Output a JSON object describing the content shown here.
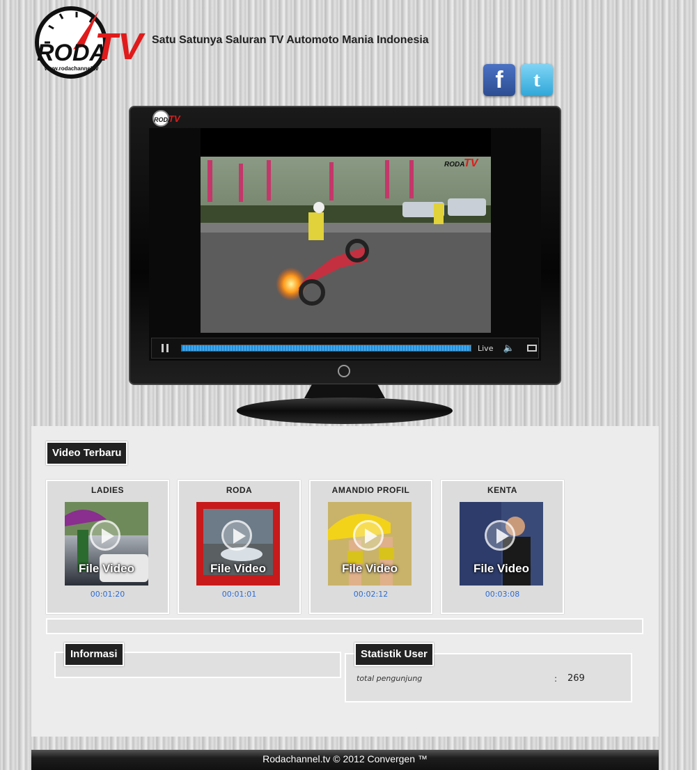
{
  "header": {
    "logo_text": "RODA",
    "logo_tv": "TV",
    "logo_url": "www.rodachannel.tv",
    "tagline": "Satu Satunya Saluran TV Automoto Mania Indonesia"
  },
  "social": {
    "facebook_glyph": "f",
    "twitter_glyph": "t"
  },
  "player": {
    "live_label": "Live",
    "progress": 1.0
  },
  "video_section": {
    "title": "Video Terbaru",
    "items": [
      {
        "title": "LADIES",
        "overlay": "File Video",
        "duration": "00:01:20"
      },
      {
        "title": "RODA",
        "overlay": "File Video",
        "duration": "00:01:01"
      },
      {
        "title": "AMANDIO PROFIL",
        "overlay": "File Video",
        "duration": "00:02:12"
      },
      {
        "title": "KENTA",
        "overlay": "File Video",
        "duration": "00:03:08"
      }
    ]
  },
  "info_section": {
    "title": "Informasi"
  },
  "stats_section": {
    "title": "Statistik User",
    "label": "total pengunjung",
    "separator": ":",
    "value": "269"
  },
  "footer": {
    "text": "Rodachannel.tv © 2012 Convergen ™"
  },
  "colors": {
    "accent_red": "#e01b1b",
    "link_blue": "#2a6bd6",
    "title_bg": "#222222"
  }
}
